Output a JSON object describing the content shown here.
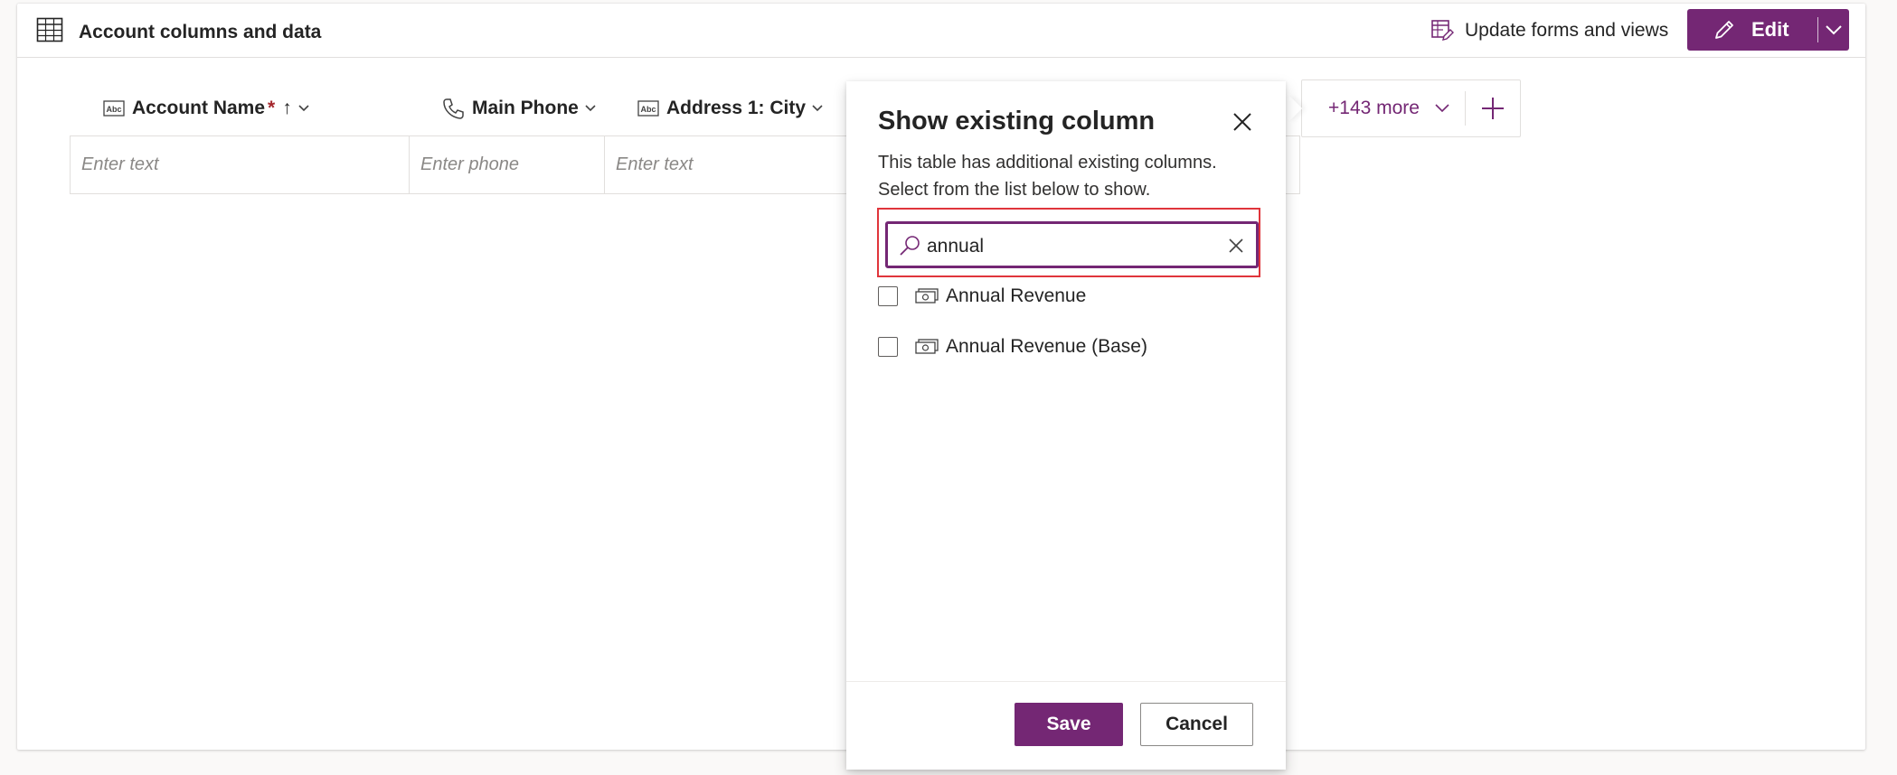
{
  "header": {
    "title": "Account columns and data",
    "update_label": "Update forms and views",
    "edit_label": "Edit"
  },
  "columns": [
    {
      "label": "Account Name",
      "required_mark": "*",
      "sort_indicator": "↑",
      "type_icon": "text-type-icon",
      "placeholder": "Enter text"
    },
    {
      "label": "Main Phone",
      "type_icon": "phone-icon",
      "placeholder": "Enter phone"
    },
    {
      "label": "Address 1: City",
      "type_icon": "text-type-icon",
      "placeholder": "Enter text"
    }
  ],
  "more_columns": {
    "label": "+143 more"
  },
  "panel": {
    "title": "Show existing column",
    "description": "This table has additional existing columns. Select from the list below to show.",
    "search_value": "annual",
    "options": [
      {
        "label": "Annual Revenue",
        "icon": "currency-icon",
        "checked": false
      },
      {
        "label": "Annual Revenue (Base)",
        "icon": "currency-icon",
        "checked": false
      }
    ],
    "save_label": "Save",
    "cancel_label": "Cancel"
  },
  "colors": {
    "accent": "#742774",
    "highlight_outline": "#e0353b",
    "required": "#a4262c"
  }
}
